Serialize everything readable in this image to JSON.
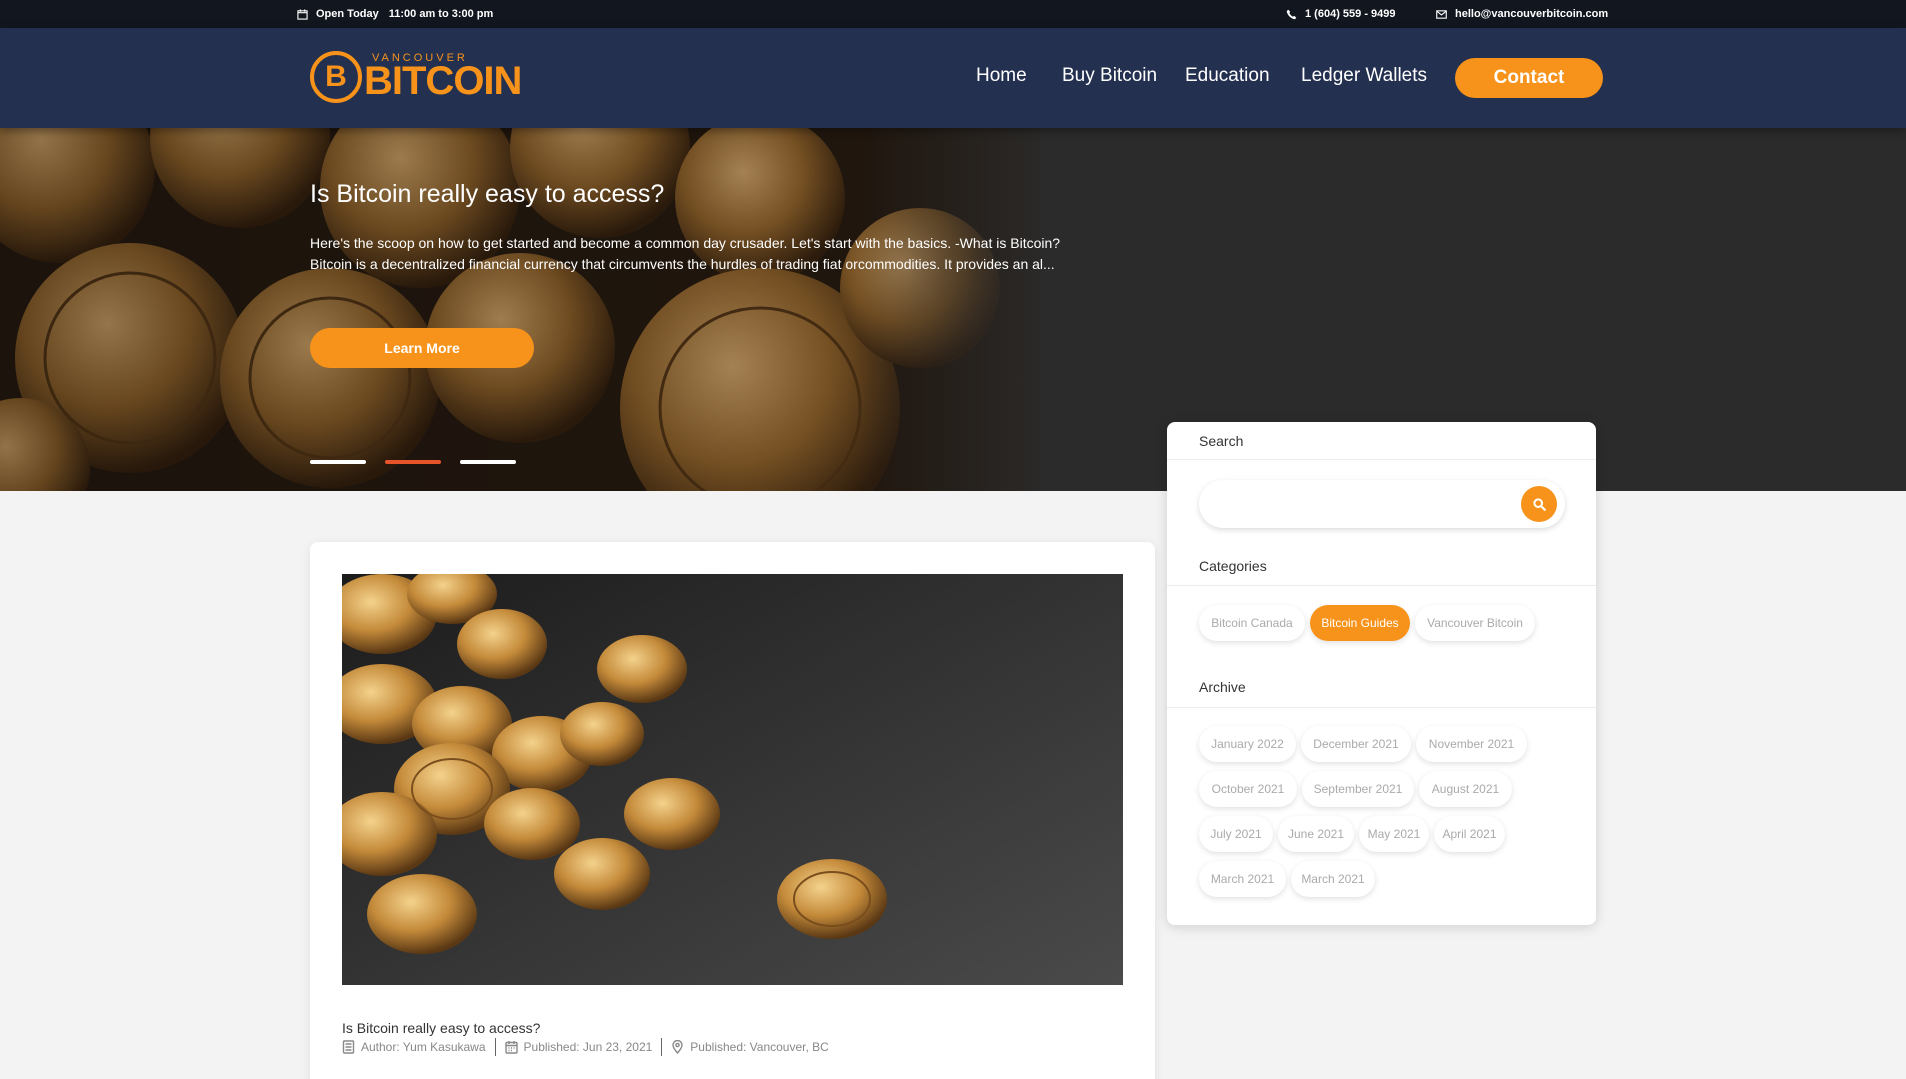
{
  "topbar": {
    "hours_label": "Open Today",
    "hours_value": "11:00 am to 3:00 pm",
    "phone": "1 (604) 559 - 9499",
    "email": "hello@vancouverbitcoin.com"
  },
  "logo": {
    "small": "VANCOUVER",
    "big": "BITCOIN",
    "coin_symbol": "B"
  },
  "nav": {
    "items": [
      "Home",
      "Buy Bitcoin",
      "Education",
      "Ledger Wallets"
    ],
    "contact": "Contact"
  },
  "hero": {
    "title": "Is Bitcoin really easy to access?",
    "text": "Here's the scoop on how to get started and become a common day crusader. Let's start with the basics. -What is Bitcoin? Bitcoin is a decentralized financial currency that circumvents the hurdles of trading fiat orcommodities. It provides an al...",
    "button": "Learn More",
    "slides_total": 3,
    "active_slide": 2
  },
  "post": {
    "title": "Is Bitcoin really easy to access?",
    "author": "Author: Yum Kasukawa",
    "published_date": "Published: Jun 23, 2021",
    "published_location": "Published: Vancouver, BC"
  },
  "sidebar": {
    "search_heading": "Search",
    "search_value": "",
    "categories_heading": "Categories",
    "categories": [
      "Bitcoin Canada",
      "Bitcoin Guides",
      "Vancouver Bitcoin"
    ],
    "active_category": "Bitcoin Guides",
    "archive_heading": "Archive",
    "archive": [
      "January 2022",
      "December 2021",
      "November 2021",
      "October 2021",
      "September 2021",
      "August 2021",
      "July 2021",
      "June 2021",
      "May 2021",
      "April 2021",
      "March 2021",
      "March 2021"
    ]
  },
  "colors": {
    "accent": "#f7931a",
    "header_bg": "#243050",
    "topbar_bg": "#11161f",
    "active_slide_dot": "#e8542a"
  },
  "icons": [
    "calendar-icon",
    "phone-icon",
    "mail-icon",
    "search-icon",
    "book-icon",
    "pin-icon"
  ]
}
